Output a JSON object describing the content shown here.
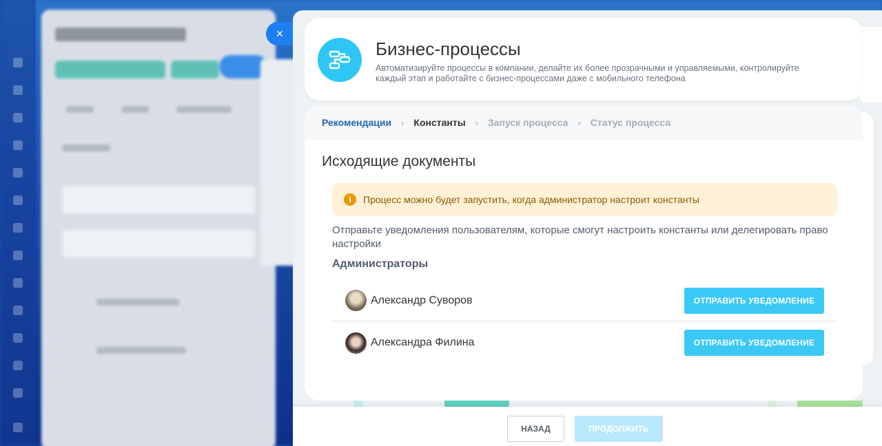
{
  "header": {
    "title": "Бизнес-процессы",
    "description": "Автоматизируйте процессы в компании, делайте их более прозрачными и управляемыми, контролируйте каждый этап и работайте с бизнес-процессами даже с мобильного телефона"
  },
  "close_label": "×",
  "steps": [
    {
      "label": "Рекомендации",
      "state": "done"
    },
    {
      "label": "Константы",
      "state": "current"
    },
    {
      "label": "Запуск процесса",
      "state": "future"
    },
    {
      "label": "Статус процесса",
      "state": "future"
    }
  ],
  "main": {
    "section_title": "Исходящие документы",
    "warning": "Процесс можно будет запустить, когда администратор настроит константы",
    "notify_text": "Отправьте уведомления пользователям, которые смогут настроить константы или делегировать право настройки",
    "admins_title": "Администраторы",
    "admins": [
      {
        "name": "Александр Суворов",
        "button": "ОТПРАВИТЬ УВЕДОМЛЕНИЕ"
      },
      {
        "name": "Александра Филина",
        "button": "ОТПРАВИТЬ УВЕДОМЛЕНИЕ"
      }
    ]
  },
  "footer": {
    "back_label": "НАЗАД",
    "continue_label": "ПРОДОЛЖИТЬ"
  },
  "colors": {
    "accent": "#2fc6f6",
    "button": "#3bc8f5",
    "step_active": "#2067b0",
    "warning_bg": "#fff1d6"
  }
}
